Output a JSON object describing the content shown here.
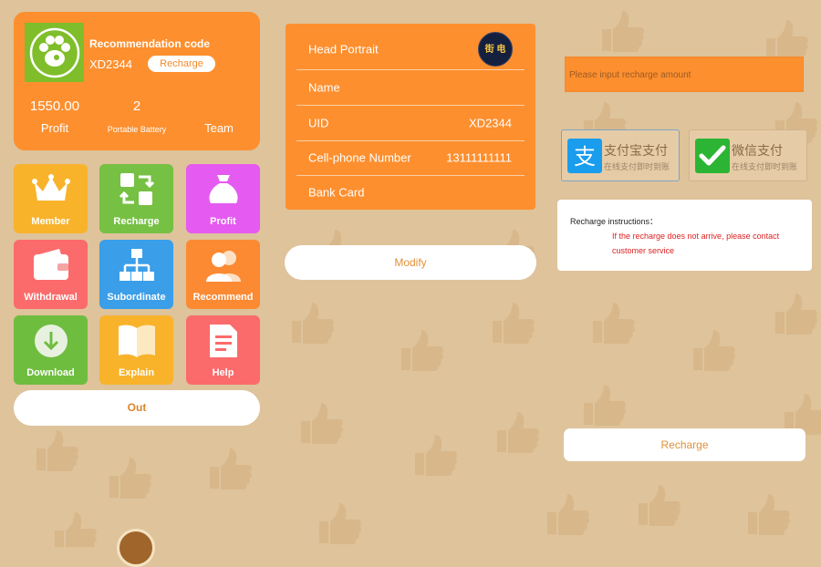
{
  "profile": {
    "rec_title": "Recommendation code",
    "rec_code": "XD2344",
    "recharge_label": "Recharge",
    "stats": [
      {
        "value": "1550.00",
        "label": "Profit"
      },
      {
        "value": "2",
        "label": "Portable Battery"
      },
      {
        "value": "",
        "label": "Team"
      }
    ]
  },
  "menu": [
    {
      "label": "Member",
      "icon": "crown-icon",
      "color": "#f8b32b"
    },
    {
      "label": "Recharge",
      "icon": "exchange-icon",
      "color": "#76c043"
    },
    {
      "label": "Profit",
      "icon": "money-bag-icon",
      "color": "#e55af0"
    },
    {
      "label": "Withdrawal",
      "icon": "wallet-icon",
      "color": "#fb6b6b"
    },
    {
      "label": "Subordinate",
      "icon": "org-chart-icon",
      "color": "#3a9ee8"
    },
    {
      "label": "Recommend",
      "icon": "users-icon",
      "color": "#fb8a33"
    },
    {
      "label": "Download",
      "icon": "download-icon",
      "color": "#6ebd3f"
    },
    {
      "label": "Explain",
      "icon": "book-icon",
      "color": "#f8b32b"
    },
    {
      "label": "Help",
      "icon": "document-icon",
      "color": "#fb6b6b"
    }
  ],
  "out_label": "Out",
  "info": {
    "rows": [
      {
        "label": "Head Portrait",
        "value": ""
      },
      {
        "label": "Name",
        "value": ""
      },
      {
        "label": "UID",
        "value": "XD2344"
      },
      {
        "label": "Cell-phone Number",
        "value": "13111111111"
      },
      {
        "label": "Bank Card",
        "value": ""
      }
    ],
    "portrait_text": "街 电"
  },
  "modify_label": "Modify",
  "recharge": {
    "placeholder": "Please input recharge amount",
    "methods": [
      {
        "name": "支付宝支付",
        "sub": "在线支付即时到账",
        "icon": "alipay-icon",
        "color": "#1a9ded"
      },
      {
        "name": "微信支付",
        "sub": "在线支付即时到账",
        "icon": "wechat-icon",
        "color": "#2cb534"
      }
    ],
    "instructions_title": "Recharge instructions：",
    "instructions_text": "If the recharge does not arrive, please contact customer service",
    "button_label": "Recharge"
  },
  "colors": {
    "accent": "#fd8f2e",
    "background": "#dec39b"
  }
}
